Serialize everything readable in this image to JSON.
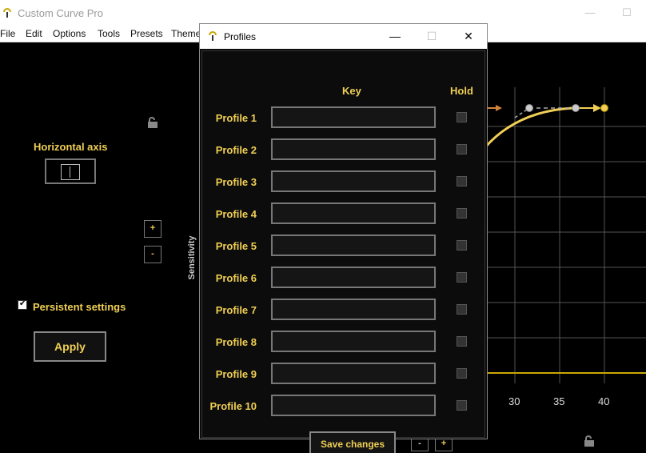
{
  "app": {
    "title": "Custom Curve Pro",
    "window_controls": [
      "—",
      "☐"
    ]
  },
  "menu": [
    "File",
    "Edit",
    "Options",
    "Tools",
    "Presets",
    "Theme"
  ],
  "left_panel": {
    "horizontal_axis_label": "Horizontal axis",
    "plus_label": "+",
    "minus_label": "-",
    "persistent_label": "Persistent settings",
    "persistent_checked": true,
    "apply_label": "Apply"
  },
  "chart_area": {
    "y_axis_label": "Sensitivity",
    "x_ticks": [
      "30",
      "35",
      "40"
    ],
    "bottom_minus": "-",
    "bottom_plus": "+"
  },
  "dialog": {
    "title": "Profiles",
    "minimize": "—",
    "maximize": "☐",
    "close": "✕",
    "key_header": "Key",
    "hold_header": "Hold",
    "profiles": [
      {
        "label": "Profile 1",
        "key": "",
        "hold": false
      },
      {
        "label": "Profile 2",
        "key": "",
        "hold": false
      },
      {
        "label": "Profile 3",
        "key": "",
        "hold": false
      },
      {
        "label": "Profile 4",
        "key": "",
        "hold": false
      },
      {
        "label": "Profile 5",
        "key": "",
        "hold": false
      },
      {
        "label": "Profile 6",
        "key": "",
        "hold": false
      },
      {
        "label": "Profile 7",
        "key": "",
        "hold": false
      },
      {
        "label": "Profile 8",
        "key": "",
        "hold": false
      },
      {
        "label": "Profile 9",
        "key": "",
        "hold": false
      },
      {
        "label": "Profile 10",
        "key": "",
        "hold": false
      }
    ],
    "save_label": "Save changes"
  },
  "colors": {
    "accent": "#f0cf54",
    "background": "#000000"
  }
}
